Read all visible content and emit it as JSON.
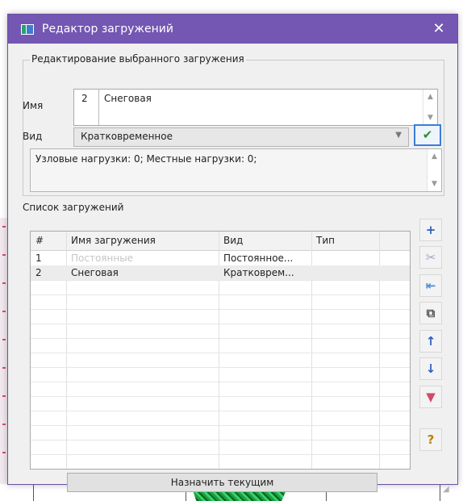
{
  "window": {
    "title": "Редактор загружений",
    "close_glyph": "✕"
  },
  "edit_group": {
    "title": "Редактирование выбранного загружения",
    "name_label": "Имя",
    "name_number": "2",
    "name_value": "Снеговая",
    "type_label": "Вид",
    "type_value": "Кратковременное",
    "info_text": "Узловые нагрузки: 0;  Местные нагрузки: 0;"
  },
  "list_group": {
    "title": "Список загружений",
    "columns": [
      "#",
      "Имя загружения",
      "Вид",
      "Тип"
    ],
    "rows": [
      {
        "num": "1",
        "name": "Постоянные",
        "kind": "Постоянное...",
        "type": ""
      },
      {
        "num": "2",
        "name": "Снеговая",
        "kind": "Кратковрем...",
        "type": ""
      }
    ]
  },
  "side_buttons": [
    {
      "name": "add-icon",
      "glyph": "+",
      "color": "#2b5fc2"
    },
    {
      "name": "cut-icon",
      "glyph": "✂",
      "color": "#9aa9c2"
    },
    {
      "name": "insert-row-icon",
      "glyph": "⇤",
      "color": "#4a8ad8"
    },
    {
      "name": "copy-icon",
      "glyph": "⧉",
      "color": "#555555"
    },
    {
      "name": "move-up-icon",
      "glyph": "↑",
      "color": "#2b5fc2"
    },
    {
      "name": "move-down-icon",
      "glyph": "↓",
      "color": "#2b5fc2"
    },
    {
      "name": "filter-icon",
      "glyph": "▼",
      "color": "#d14a6a"
    },
    {
      "name": "help-icon",
      "glyph": "?",
      "color": "#b88400"
    }
  ],
  "assign_button": "Назначить текущим",
  "colors": {
    "titlebar": "#7456b3",
    "accent": "#3b7dd8"
  }
}
